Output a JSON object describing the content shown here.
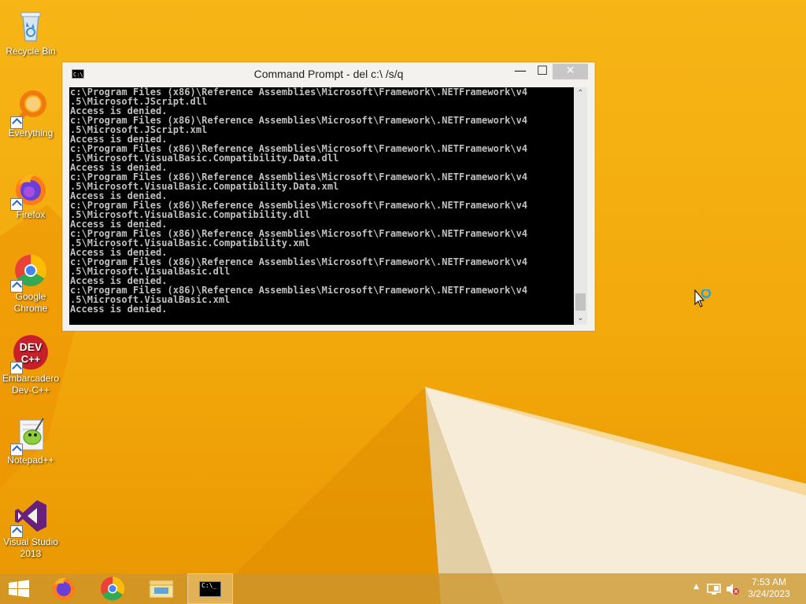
{
  "desktop": {
    "icons": [
      {
        "label": "Recycle Bin",
        "icon": "recycle-bin-icon"
      },
      {
        "label": "Everything",
        "icon": "everything-search-icon"
      },
      {
        "label": "Firefox",
        "icon": "firefox-icon"
      },
      {
        "label": "Google Chrome",
        "icon": "chrome-icon"
      },
      {
        "label": "Embarcadero Dev-C++",
        "icon": "devcpp-icon"
      },
      {
        "label": "Notepad++",
        "icon": "notepadpp-icon"
      },
      {
        "label": "Visual Studio 2013",
        "icon": "visual-studio-icon"
      }
    ]
  },
  "window": {
    "title": "Command Prompt - del  c:\\ /s/q",
    "icon_text": "C:\\_",
    "minimize": "—",
    "maximize": "☐",
    "close": "✕",
    "console_lines": [
      "c:\\Program Files (x86)\\Reference Assemblies\\Microsoft\\Framework\\.NETFramework\\v4",
      ".5\\Microsoft.JScript.dll",
      "Access is denied.",
      "c:\\Program Files (x86)\\Reference Assemblies\\Microsoft\\Framework\\.NETFramework\\v4",
      ".5\\Microsoft.JScript.xml",
      "Access is denied.",
      "c:\\Program Files (x86)\\Reference Assemblies\\Microsoft\\Framework\\.NETFramework\\v4",
      ".5\\Microsoft.VisualBasic.Compatibility.Data.dll",
      "Access is denied.",
      "c:\\Program Files (x86)\\Reference Assemblies\\Microsoft\\Framework\\.NETFramework\\v4",
      ".5\\Microsoft.VisualBasic.Compatibility.Data.xml",
      "Access is denied.",
      "c:\\Program Files (x86)\\Reference Assemblies\\Microsoft\\Framework\\.NETFramework\\v4",
      ".5\\Microsoft.VisualBasic.Compatibility.dll",
      "Access is denied.",
      "c:\\Program Files (x86)\\Reference Assemblies\\Microsoft\\Framework\\.NETFramework\\v4",
      ".5\\Microsoft.VisualBasic.Compatibility.xml",
      "Access is denied.",
      "c:\\Program Files (x86)\\Reference Assemblies\\Microsoft\\Framework\\.NETFramework\\v4",
      ".5\\Microsoft.VisualBasic.dll",
      "Access is denied.",
      "c:\\Program Files (x86)\\Reference Assemblies\\Microsoft\\Framework\\.NETFramework\\v4",
      ".5\\Microsoft.VisualBasic.xml",
      "Access is denied."
    ]
  },
  "taskbar": {
    "start": "start-icon",
    "pinned": [
      "firefox-icon",
      "chrome-icon",
      "file-explorer-icon",
      "command-prompt-icon"
    ],
    "active": "command-prompt-icon",
    "cmd_icon_text": "C:\\_",
    "tray": {
      "show_hidden": "▲",
      "network": "network-icon",
      "volume": "volume-muted-icon",
      "time": "7:53 AM",
      "date": "3/24/2023"
    }
  },
  "colors": {
    "desktop_bg": "#f2a90b",
    "console_bg": "#000000",
    "console_text": "#c0c0c0",
    "taskbar_bg": "#cd962d"
  }
}
